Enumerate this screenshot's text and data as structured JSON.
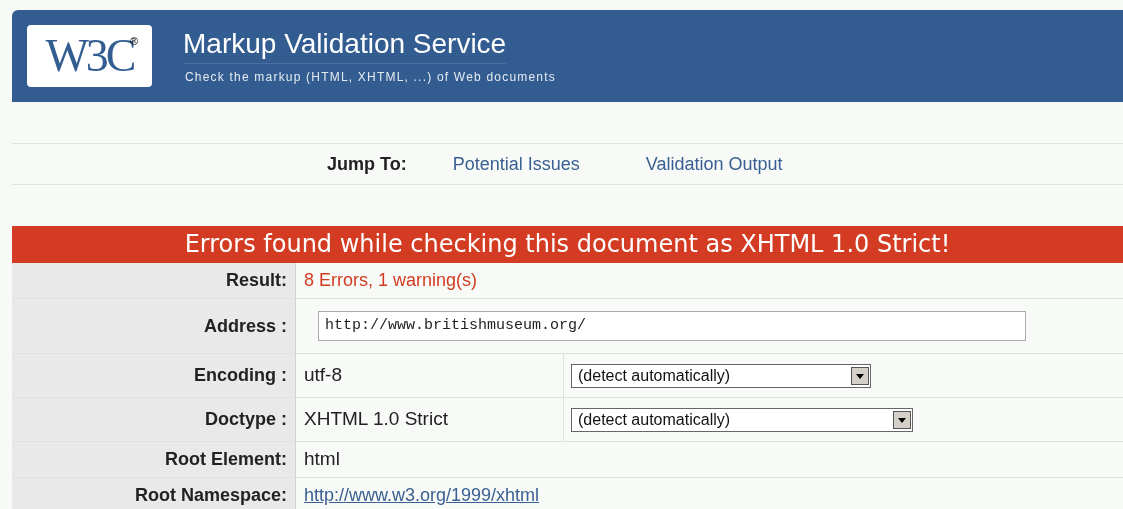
{
  "header": {
    "logo": "W3C",
    "registered_mark": "®",
    "title": "Markup Validation Service",
    "subtitle": "Check the markup (HTML, XHTML, ...) of Web documents"
  },
  "jump": {
    "label": "Jump To:",
    "links": [
      "Potential Issues",
      "Validation Output"
    ]
  },
  "banner": "Errors found while checking this document as XHTML 1.0 Strict!",
  "rows": [
    {
      "label": "Result:",
      "kind": "result",
      "value": "8 Errors, 1 warning(s)"
    },
    {
      "label": "Address :",
      "kind": "input",
      "value": "http://www.britishmuseum.org/"
    },
    {
      "label": "Encoding :",
      "kind": "select",
      "value": "utf-8",
      "option": "(detect automatically)"
    },
    {
      "label": "Doctype :",
      "kind": "select",
      "value": "XHTML 1.0 Strict",
      "option": "(detect automatically)"
    },
    {
      "label": "Root Element:",
      "kind": "text",
      "value": "html"
    },
    {
      "label": "Root Namespace:",
      "kind": "link",
      "value": "http://www.w3.org/1999/xhtml"
    }
  ]
}
